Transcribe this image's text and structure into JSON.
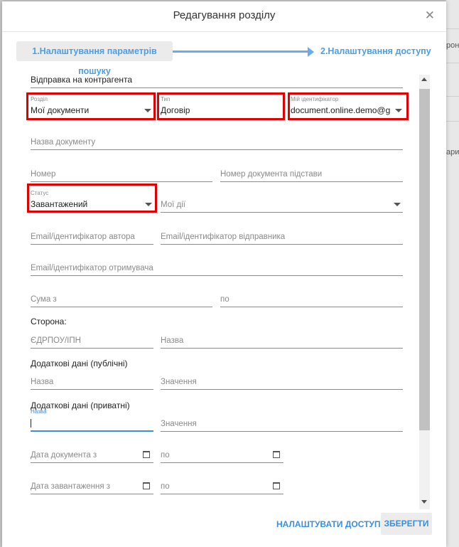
{
  "dialog": {
    "title": "Редагування розділу",
    "close_glyph": "✕"
  },
  "steps": {
    "step1": "1.Налаштування параметрів пошуку",
    "step2": "2.Налаштування доступу"
  },
  "form": {
    "send_to_counterparty": "Відправка на контрагента",
    "section": {
      "label": "Розділ",
      "value": "Мої документи"
    },
    "type": {
      "label": "Тип",
      "value": "Договір"
    },
    "my_id": {
      "label": "Мій ідентифікатор",
      "value": "document.online.demo@g..."
    },
    "doc_name": "Назва документу",
    "number": "Номер",
    "basis_number": "Номер документа підстави",
    "status": {
      "label": "Статус",
      "value": "Завантажений"
    },
    "my_actions": "Мої дії",
    "author_email": "Email/ідентифікатор автора",
    "sender_email": "Email/ідентифікатор відправника",
    "recipient_email": "Email/ідентифікатор отримувача",
    "sum_from": "Сума з",
    "sum_to": "по",
    "party_heading": "Сторона:",
    "party_code": "ЄДРПОУ/ІПН",
    "party_name": "Назва",
    "public_heading": "Додаткові дані (публічні)",
    "public_name": "Назва",
    "public_value": "Значення",
    "private_heading": "Додаткові дані (приватні)",
    "private_name_label": "Назва",
    "private_value": "Значення",
    "doc_date_from": "Дата документа з",
    "doc_date_to": "по",
    "upload_date_from": "Дата завантаження з",
    "upload_date_to": "по"
  },
  "buttons": {
    "configure_access": "НАЛАШТУВАТИ ДОСТУП",
    "save": "ЗБЕРЕГТИ"
  },
  "background": {
    "fragment_1": "рон",
    "fragment_2": "ари"
  },
  "colors": {
    "accent": "#3b8fe0",
    "highlight_box": "#e00000",
    "step_arrow": "#6aaaf0"
  }
}
